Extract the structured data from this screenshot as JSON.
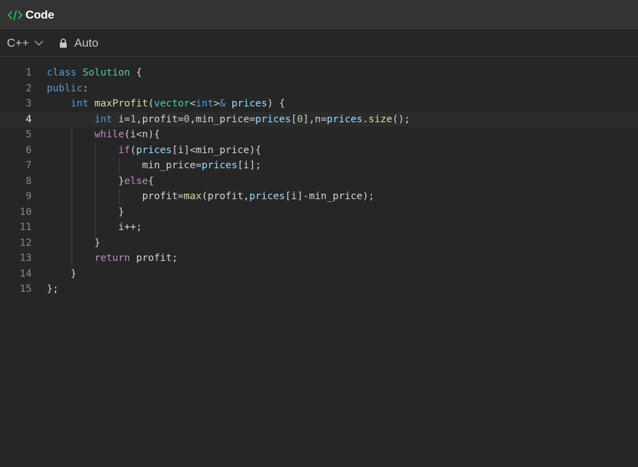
{
  "header": {
    "icon": "code-icon",
    "title": "Code"
  },
  "toolbar": {
    "language": "C++",
    "mode": "Auto"
  },
  "colors": {
    "code_icon": "#2cbb5d",
    "keyword": "#569cd6",
    "control": "#c586c0",
    "type": "#4ec9b0",
    "function": "#dcdcaa",
    "variable": "#9cdcfe",
    "number": "#b5cea8"
  },
  "editor": {
    "active_line": 4,
    "lines": [
      {
        "n": "1",
        "tokens": [
          [
            "kw",
            "class "
          ],
          [
            "ty",
            "Solution"
          ],
          [
            "pun",
            " {"
          ]
        ]
      },
      {
        "n": "2",
        "tokens": [
          [
            "kw",
            "public"
          ],
          [
            "pun",
            ":"
          ]
        ]
      },
      {
        "n": "3",
        "tokens": [
          [
            "pun",
            "    "
          ],
          [
            "kw",
            "int"
          ],
          [
            "pun",
            " "
          ],
          [
            "fn",
            "maxProfit"
          ],
          [
            "pun",
            "("
          ],
          [
            "ty",
            "vector"
          ],
          [
            "pun",
            "<"
          ],
          [
            "kw",
            "int"
          ],
          [
            "pun",
            ">"
          ],
          [
            "kw",
            "&"
          ],
          [
            "pun",
            " "
          ],
          [
            "var",
            "prices"
          ],
          [
            "pun",
            ") {"
          ]
        ]
      },
      {
        "n": "4",
        "tokens": [
          [
            "pun",
            "        "
          ],
          [
            "kw",
            "int"
          ],
          [
            "pun",
            " i="
          ],
          [
            "num",
            "1"
          ],
          [
            "pun",
            ",profit="
          ],
          [
            "num",
            "0"
          ],
          [
            "pun",
            ",min_price="
          ],
          [
            "var",
            "prices"
          ],
          [
            "pun",
            "["
          ],
          [
            "num",
            "0"
          ],
          [
            "pun",
            "],n="
          ],
          [
            "var",
            "prices"
          ],
          [
            "pun",
            "."
          ],
          [
            "fn",
            "size"
          ],
          [
            "pun",
            "();"
          ]
        ]
      },
      {
        "n": "5",
        "tokens": [
          [
            "pun",
            "        "
          ],
          [
            "ctl",
            "while"
          ],
          [
            "pun",
            "(i<n){"
          ]
        ]
      },
      {
        "n": "6",
        "tokens": [
          [
            "pun",
            "            "
          ],
          [
            "ctl",
            "if"
          ],
          [
            "pun",
            "("
          ],
          [
            "var",
            "prices"
          ],
          [
            "pun",
            "[i]<min_price){"
          ]
        ]
      },
      {
        "n": "7",
        "tokens": [
          [
            "pun",
            "                min_price="
          ],
          [
            "var",
            "prices"
          ],
          [
            "pun",
            "[i];"
          ]
        ]
      },
      {
        "n": "8",
        "tokens": [
          [
            "pun",
            "            }"
          ],
          [
            "ctl",
            "else"
          ],
          [
            "pun",
            "{"
          ]
        ]
      },
      {
        "n": "9",
        "tokens": [
          [
            "pun",
            "                profit="
          ],
          [
            "fn",
            "max"
          ],
          [
            "pun",
            "(profit,"
          ],
          [
            "var",
            "prices"
          ],
          [
            "pun",
            "[i]-min_price);"
          ]
        ]
      },
      {
        "n": "10",
        "tokens": [
          [
            "pun",
            "            }"
          ]
        ]
      },
      {
        "n": "11",
        "tokens": [
          [
            "pun",
            "            i++;"
          ]
        ]
      },
      {
        "n": "12",
        "tokens": [
          [
            "pun",
            "        }"
          ]
        ]
      },
      {
        "n": "13",
        "tokens": [
          [
            "pun",
            "        "
          ],
          [
            "ctl",
            "return"
          ],
          [
            "pun",
            " profit;"
          ]
        ]
      },
      {
        "n": "14",
        "tokens": [
          [
            "pun",
            "    }"
          ]
        ]
      },
      {
        "n": "15",
        "tokens": [
          [
            "pun",
            "};"
          ]
        ]
      }
    ]
  }
}
